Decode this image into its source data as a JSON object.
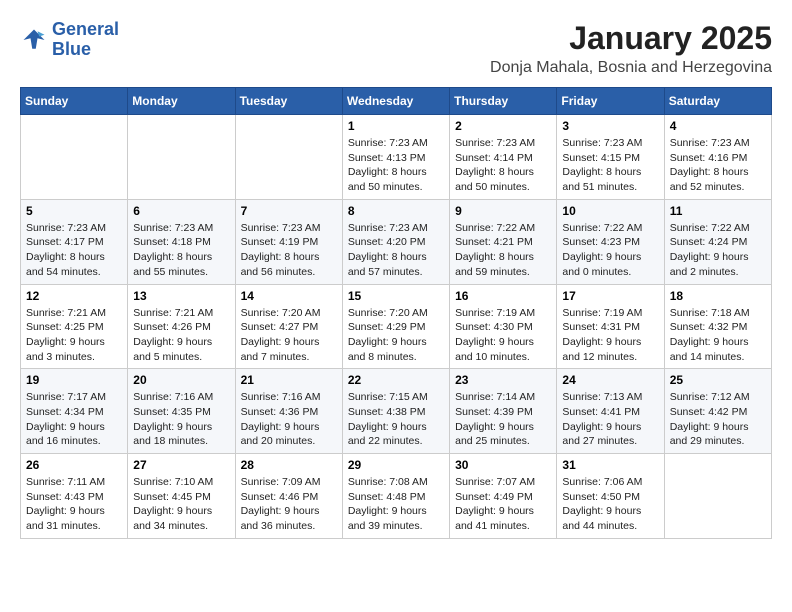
{
  "header": {
    "logo_line1": "General",
    "logo_line2": "Blue",
    "month_title": "January 2025",
    "location": "Donja Mahala, Bosnia and Herzegovina"
  },
  "days_of_week": [
    "Sunday",
    "Monday",
    "Tuesday",
    "Wednesday",
    "Thursday",
    "Friday",
    "Saturday"
  ],
  "weeks": [
    [
      {
        "day": "",
        "info": ""
      },
      {
        "day": "",
        "info": ""
      },
      {
        "day": "",
        "info": ""
      },
      {
        "day": "1",
        "info": "Sunrise: 7:23 AM\nSunset: 4:13 PM\nDaylight: 8 hours\nand 50 minutes."
      },
      {
        "day": "2",
        "info": "Sunrise: 7:23 AM\nSunset: 4:14 PM\nDaylight: 8 hours\nand 50 minutes."
      },
      {
        "day": "3",
        "info": "Sunrise: 7:23 AM\nSunset: 4:15 PM\nDaylight: 8 hours\nand 51 minutes."
      },
      {
        "day": "4",
        "info": "Sunrise: 7:23 AM\nSunset: 4:16 PM\nDaylight: 8 hours\nand 52 minutes."
      }
    ],
    [
      {
        "day": "5",
        "info": "Sunrise: 7:23 AM\nSunset: 4:17 PM\nDaylight: 8 hours\nand 54 minutes."
      },
      {
        "day": "6",
        "info": "Sunrise: 7:23 AM\nSunset: 4:18 PM\nDaylight: 8 hours\nand 55 minutes."
      },
      {
        "day": "7",
        "info": "Sunrise: 7:23 AM\nSunset: 4:19 PM\nDaylight: 8 hours\nand 56 minutes."
      },
      {
        "day": "8",
        "info": "Sunrise: 7:23 AM\nSunset: 4:20 PM\nDaylight: 8 hours\nand 57 minutes."
      },
      {
        "day": "9",
        "info": "Sunrise: 7:22 AM\nSunset: 4:21 PM\nDaylight: 8 hours\nand 59 minutes."
      },
      {
        "day": "10",
        "info": "Sunrise: 7:22 AM\nSunset: 4:23 PM\nDaylight: 9 hours\nand 0 minutes."
      },
      {
        "day": "11",
        "info": "Sunrise: 7:22 AM\nSunset: 4:24 PM\nDaylight: 9 hours\nand 2 minutes."
      }
    ],
    [
      {
        "day": "12",
        "info": "Sunrise: 7:21 AM\nSunset: 4:25 PM\nDaylight: 9 hours\nand 3 minutes."
      },
      {
        "day": "13",
        "info": "Sunrise: 7:21 AM\nSunset: 4:26 PM\nDaylight: 9 hours\nand 5 minutes."
      },
      {
        "day": "14",
        "info": "Sunrise: 7:20 AM\nSunset: 4:27 PM\nDaylight: 9 hours\nand 7 minutes."
      },
      {
        "day": "15",
        "info": "Sunrise: 7:20 AM\nSunset: 4:29 PM\nDaylight: 9 hours\nand 8 minutes."
      },
      {
        "day": "16",
        "info": "Sunrise: 7:19 AM\nSunset: 4:30 PM\nDaylight: 9 hours\nand 10 minutes."
      },
      {
        "day": "17",
        "info": "Sunrise: 7:19 AM\nSunset: 4:31 PM\nDaylight: 9 hours\nand 12 minutes."
      },
      {
        "day": "18",
        "info": "Sunrise: 7:18 AM\nSunset: 4:32 PM\nDaylight: 9 hours\nand 14 minutes."
      }
    ],
    [
      {
        "day": "19",
        "info": "Sunrise: 7:17 AM\nSunset: 4:34 PM\nDaylight: 9 hours\nand 16 minutes."
      },
      {
        "day": "20",
        "info": "Sunrise: 7:16 AM\nSunset: 4:35 PM\nDaylight: 9 hours\nand 18 minutes."
      },
      {
        "day": "21",
        "info": "Sunrise: 7:16 AM\nSunset: 4:36 PM\nDaylight: 9 hours\nand 20 minutes."
      },
      {
        "day": "22",
        "info": "Sunrise: 7:15 AM\nSunset: 4:38 PM\nDaylight: 9 hours\nand 22 minutes."
      },
      {
        "day": "23",
        "info": "Sunrise: 7:14 AM\nSunset: 4:39 PM\nDaylight: 9 hours\nand 25 minutes."
      },
      {
        "day": "24",
        "info": "Sunrise: 7:13 AM\nSunset: 4:41 PM\nDaylight: 9 hours\nand 27 minutes."
      },
      {
        "day": "25",
        "info": "Sunrise: 7:12 AM\nSunset: 4:42 PM\nDaylight: 9 hours\nand 29 minutes."
      }
    ],
    [
      {
        "day": "26",
        "info": "Sunrise: 7:11 AM\nSunset: 4:43 PM\nDaylight: 9 hours\nand 31 minutes."
      },
      {
        "day": "27",
        "info": "Sunrise: 7:10 AM\nSunset: 4:45 PM\nDaylight: 9 hours\nand 34 minutes."
      },
      {
        "day": "28",
        "info": "Sunrise: 7:09 AM\nSunset: 4:46 PM\nDaylight: 9 hours\nand 36 minutes."
      },
      {
        "day": "29",
        "info": "Sunrise: 7:08 AM\nSunset: 4:48 PM\nDaylight: 9 hours\nand 39 minutes."
      },
      {
        "day": "30",
        "info": "Sunrise: 7:07 AM\nSunset: 4:49 PM\nDaylight: 9 hours\nand 41 minutes."
      },
      {
        "day": "31",
        "info": "Sunrise: 7:06 AM\nSunset: 4:50 PM\nDaylight: 9 hours\nand 44 minutes."
      },
      {
        "day": "",
        "info": ""
      }
    ]
  ]
}
